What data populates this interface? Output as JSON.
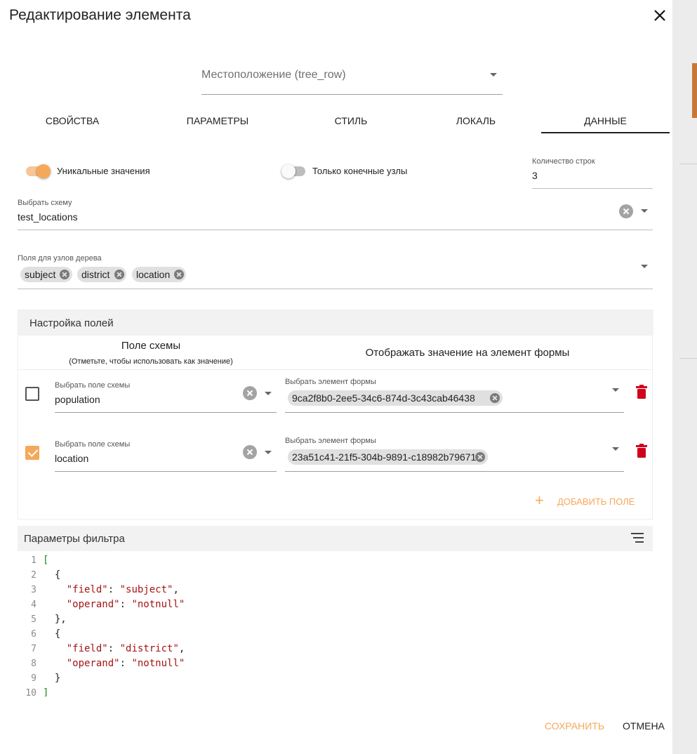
{
  "dialog": {
    "title": "Редактирование элемента"
  },
  "location_select": {
    "value": "Местоположение (tree_row)"
  },
  "tabs": [
    {
      "label": "СВОЙСТВА"
    },
    {
      "label": "ПАРАМЕТРЫ"
    },
    {
      "label": "СТИЛЬ"
    },
    {
      "label": "ЛОКАЛЬ"
    },
    {
      "label": "ДАННЫЕ",
      "active": true
    }
  ],
  "toggles": {
    "unique": {
      "label": "Уникальные значения",
      "on": true
    },
    "leaf_only": {
      "label": "Только конечные узлы",
      "on": false
    }
  },
  "row_count": {
    "label": "Количество строк",
    "value": "3"
  },
  "schema": {
    "label": "Выбрать схему",
    "value": "test_locations"
  },
  "tree_fields": {
    "label": "Поля для узлов дерева",
    "chips": [
      "subject",
      "district",
      "location"
    ]
  },
  "fields_panel": {
    "title": "Настройка полей",
    "col_schema": "Поле схемы",
    "col_schema_hint": "(Отметьте, чтобы использовать как значение)",
    "col_display": "Отображать значение на элемент формы",
    "rows": [
      {
        "checked": false,
        "schema_label": "Выбрать поле схемы",
        "schema_value": "population",
        "form_label": "Выбрать элемент формы",
        "form_chip": "9ca2f8b0-2ee5-34c6-874d-3c43cab46438"
      },
      {
        "checked": true,
        "schema_label": "Выбрать поле схемы",
        "schema_value": "location",
        "form_label": "Выбрать элемент формы",
        "form_chip": "23a51c41-21f5-304b-9891-c18982b79671"
      }
    ],
    "add_label": "ДОБАВИТЬ ПОЛЕ"
  },
  "filter": {
    "title": "Параметры фильтра",
    "line_numbers": [
      "1",
      "2",
      "3",
      "4",
      "5",
      "6",
      "7",
      "8",
      "9",
      "10"
    ]
  },
  "footer": {
    "save_label": "СОХРАНИТЬ",
    "cancel_label": "ОТМЕНА"
  },
  "colors": {
    "accent": "#f6a85a",
    "danger": "#d0021b",
    "code_key": "#a31515",
    "code_bracket": "#1a8a1a"
  }
}
